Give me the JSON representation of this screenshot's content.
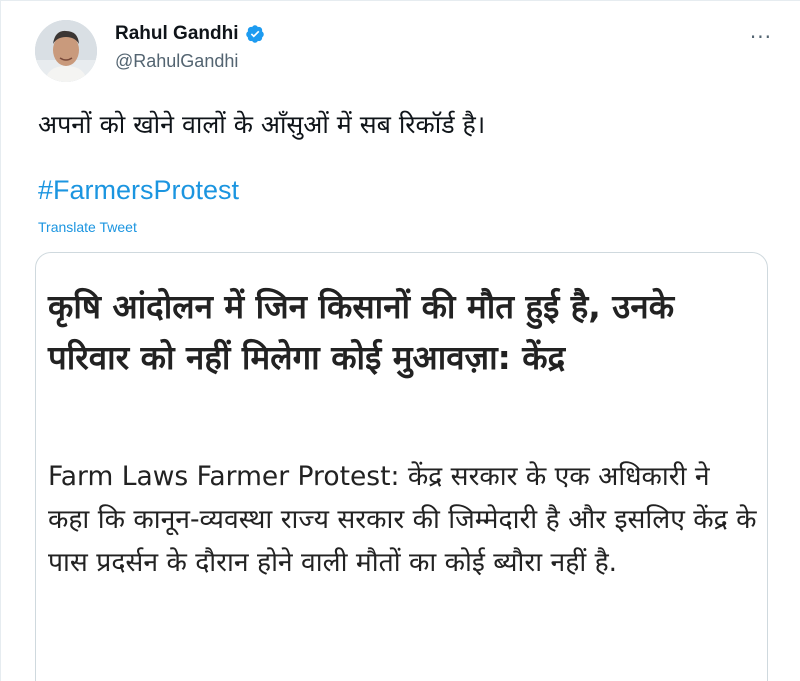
{
  "tweet": {
    "author_name": "Rahul Gandhi",
    "author_handle": "@RahulGandhi",
    "verified_icon": "verified-badge-icon",
    "more_icon": "more-options-icon",
    "text": "अपनों को खोने वालों के आँसुओं में सब रिकॉर्ड है।",
    "hashtag": "#FarmersProtest",
    "translate_label": "Translate Tweet"
  },
  "card": {
    "headline": "कृषि आंदोलन में जिन किसानों की मौत हुई है, उनके परिवार को नहीं मिलेगा कोई मुआवज़ा: केंद्र",
    "description": "Farm Laws Farmer Protest: केंद्र सरकार के एक अधिकारी ने कहा कि कानून-व्यवस्था राज्य सरकार की जिम्मेदारी है और इसलिए केंद्र के पास प्रदर्सन के दौरान होने वाली मौतों का कोई ब्यौरा नहीं है."
  },
  "colors": {
    "link": "#1b95e0",
    "verified": "#1d9bf0",
    "secondary_text": "#536471"
  }
}
